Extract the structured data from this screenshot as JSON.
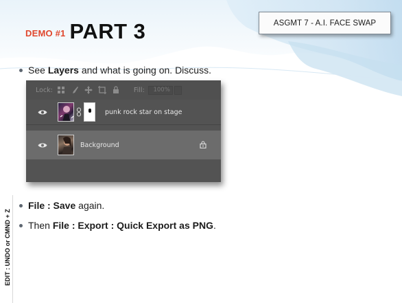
{
  "slide": {
    "demo_label": "DEMO #1",
    "title": "PART 3",
    "badge": "ASGMT 7 - A.I. FACE SWAP",
    "side_label": "EDIT : UNDO or CMND + Z"
  },
  "bullets": {
    "b1": {
      "pre": "See ",
      "bold": "Layers",
      "post": " and what is going on. Discuss."
    },
    "b2": {
      "bold": "File : Save",
      "post": " again."
    },
    "b3": {
      "pre": "Then ",
      "bold": "File : Export : Quick Export as PNG",
      "post": "."
    }
  },
  "layers_panel": {
    "lock_label": "Lock:",
    "fill_label": "Fill:",
    "fill_value": "100%",
    "layers": [
      {
        "name": "punk rock star on stage",
        "visible": true,
        "has_mask": true
      },
      {
        "name": "Background",
        "visible": true,
        "locked": true
      }
    ]
  },
  "colors": {
    "demo_accent": "#e0462c",
    "panel_bg": "#535353",
    "selected_row": "#6c6c6c"
  },
  "icons": [
    "eye-icon",
    "chain-link-icon",
    "lock-icon",
    "move-icon",
    "brush-icon",
    "artboard-icon",
    "transparency-lock-icon"
  ]
}
